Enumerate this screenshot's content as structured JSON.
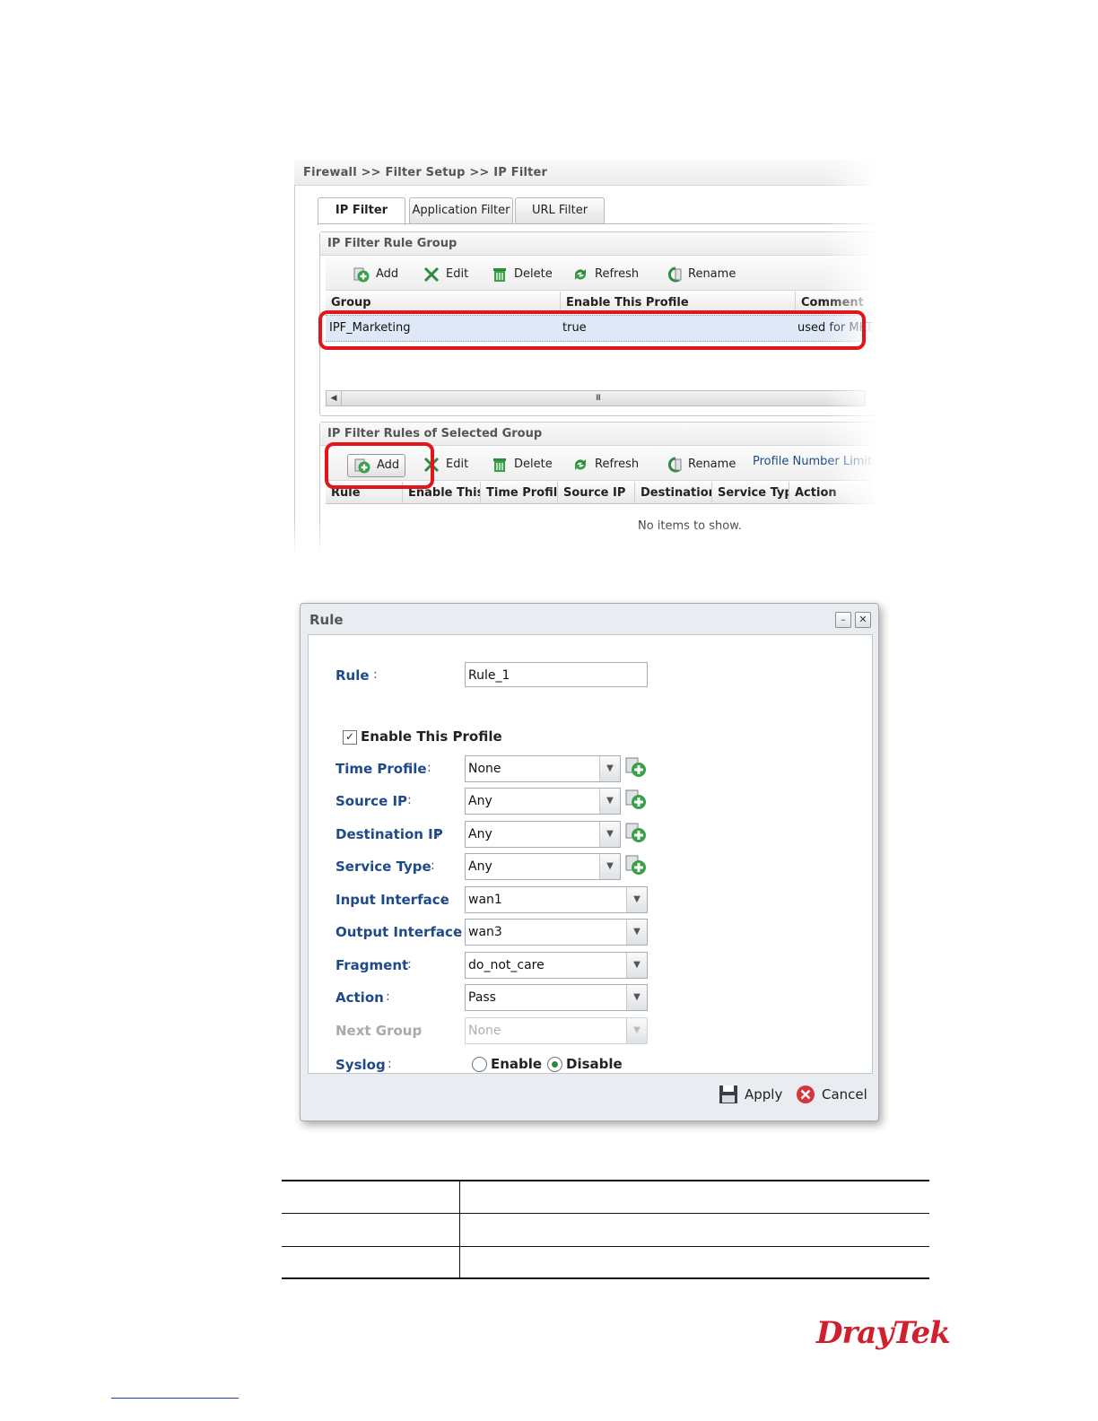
{
  "breadcrumb": "Firewall >> Filter Setup >> IP Filter",
  "tabs": [
    {
      "label": "IP Filter",
      "active": true
    },
    {
      "label": "Application Filter",
      "active": false
    },
    {
      "label": "URL Filter",
      "active": false
    }
  ],
  "rule_group": {
    "title": "IP Filter Rule Group",
    "toolbar": {
      "add": "Add",
      "edit": "Edit",
      "delete": "Delete",
      "refresh": "Refresh",
      "rename": "Rename"
    },
    "columns": [
      "Group",
      "Enable This Profile",
      "Comment"
    ],
    "rows": [
      {
        "group": "IPF_Marketing",
        "enable": "true",
        "comment": "used for MKT"
      }
    ],
    "scroll_grip": "III"
  },
  "rules": {
    "title": "IP Filter Rules of Selected Group",
    "toolbar": {
      "add": "Add",
      "edit": "Edit",
      "delete": "Delete",
      "refresh": "Refresh",
      "rename": "Rename",
      "profile_limit": "Profile Number Limit"
    },
    "columns": [
      "Rule",
      "Enable This",
      "Time Profile",
      "Source IP",
      "Destination",
      "Service Typ",
      "Action"
    ],
    "empty_text": "No items to show."
  },
  "dialog": {
    "title": "Rule",
    "fields": {
      "rule_label": "Rule",
      "rule_value": "Rule_1",
      "enable_label": "Enable This Profile",
      "enable_checked": true,
      "time_profile_label": "Time Profile",
      "time_profile_value": "None",
      "source_ip_label": "Source IP",
      "source_ip_value": "Any",
      "dest_ip_label": "Destination IP",
      "dest_ip_value": "Any",
      "service_type_label": "Service Type",
      "service_type_value": "Any",
      "input_if_label": "Input Interface",
      "input_if_value": "wan1",
      "output_if_label": "Output Interface",
      "output_if_value": "wan3",
      "fragment_label": "Fragment",
      "fragment_value": "do_not_care",
      "action_label": "Action",
      "action_value": "Pass",
      "next_group_label": "Next Group",
      "next_group_value": "None",
      "syslog_label": "Syslog",
      "syslog_enable": "Enable",
      "syslog_disable": "Disable",
      "syslog_selected": "Disable"
    },
    "colon": ":",
    "footer": {
      "apply": "Apply",
      "cancel": "Cancel"
    }
  },
  "brand": {
    "logo_text": "DrayTek",
    "color": "#d0202e"
  },
  "colors": {
    "label_blue": "#1f4a87",
    "highlight_red": "#e3151a",
    "row_select": "#dfe8f6"
  }
}
